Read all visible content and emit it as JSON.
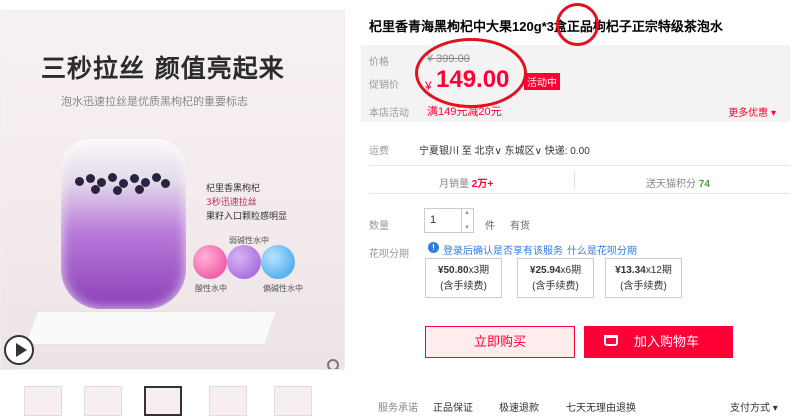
{
  "product": {
    "title": "杞里香青海黑枸杞中大果120g*3盒正品枸杞子正宗特级茶泡水"
  },
  "gallery": {
    "headline": "三秒拉丝  颜值亮起来",
    "subline": "泡水迅速拉丝是优质黑枸杞的重要标志",
    "annotations": [
      "杞里香黑枸杞",
      "3秒迅速拉丝",
      "果籽入口颗粒感明显"
    ],
    "bubble_labels": [
      "酸性水中",
      "弱碱性水中",
      "偏碱性水中"
    ],
    "thumbnail_count": 7,
    "selected_thumbnail": 3
  },
  "pricing": {
    "original_label": "价格",
    "original_price": "¥ 399.00",
    "promo_label": "促销价",
    "currency": "¥",
    "price": "149.00",
    "badge": "活动中",
    "store_label": "本店活动",
    "store_promo": "满149元减20元",
    "more_promos": "更多优惠 ▾"
  },
  "shipping": {
    "label": "运费",
    "value": "宁夏银川  至 北京∨ 东城区∨  快递: 0.00"
  },
  "stats": {
    "monthly_label": "月销量",
    "monthly_value": "2万+",
    "points_label": "送天猫积分",
    "points_value": "74"
  },
  "quantity": {
    "label": "数量",
    "value": "1",
    "unit": "件",
    "stock": "有货"
  },
  "huabei": {
    "label": "花呗分期",
    "note": "登录后确认是否享有该服务",
    "link": "什么是花呗分期",
    "installments": [
      {
        "amount": "¥50.80",
        "periods": "x3期",
        "fee": "(含手续费)"
      },
      {
        "amount": "¥25.94",
        "periods": "x6期",
        "fee": "(含手续费)"
      },
      {
        "amount": "¥13.34",
        "periods": "x12期",
        "fee": "(含手续费)"
      }
    ]
  },
  "actions": {
    "buy_now": "立即购买",
    "add_to_cart": "加入购物车"
  },
  "services": {
    "label": "服务承诺",
    "items": [
      "正品保证",
      "极速退款",
      "七天无理由退换"
    ],
    "payment": "支付方式 ▾"
  },
  "colors": {
    "accent": "#ff0036",
    "annotation_circle": "#e3101f",
    "link": "#2f7de1"
  }
}
